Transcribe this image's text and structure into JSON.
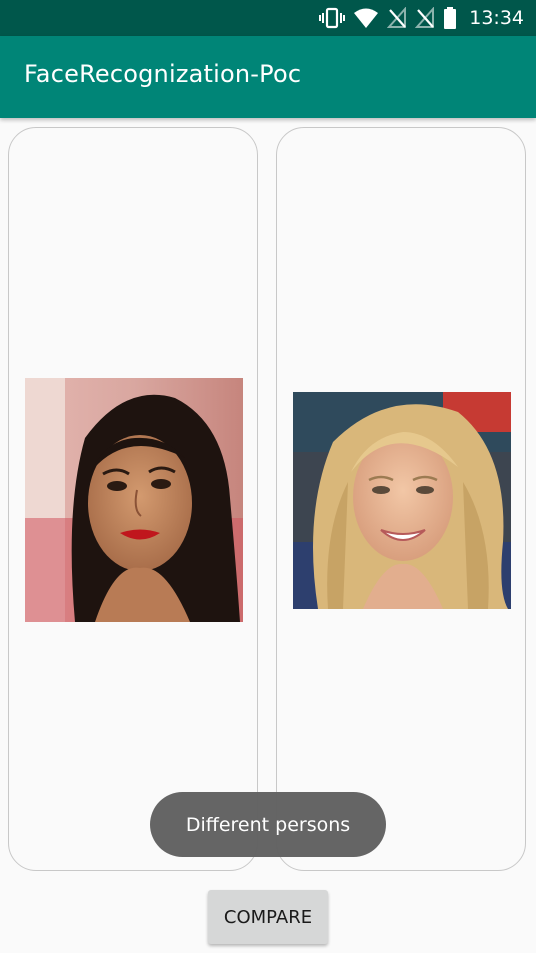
{
  "status_bar": {
    "time": "13:34",
    "icons": [
      "vibrate-icon",
      "wifi-icon",
      "no-sim-icon",
      "no-sim-icon",
      "battery-icon"
    ]
  },
  "app_bar": {
    "title": "FaceRecognization-Poc"
  },
  "images": {
    "left": {
      "description_icon": "face-photo-icon"
    },
    "right": {
      "description_icon": "face-photo-icon"
    }
  },
  "toast": {
    "message": "Different persons"
  },
  "actions": {
    "compare_label": "COMPARE"
  },
  "colors": {
    "status_bar": "#00574b",
    "app_bar": "#008577",
    "background": "#fafafa",
    "toast": "#616161",
    "button": "#d6d7d7"
  }
}
